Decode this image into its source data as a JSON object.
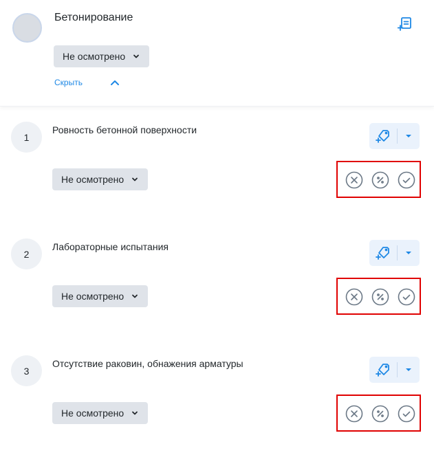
{
  "header": {
    "title": "Бетонирование",
    "status": "Не осмотрено",
    "hide_label": "Скрыть",
    "action_icon": "add-document-icon"
  },
  "items": [
    {
      "number": "1",
      "title": "Ровность бетонной поверхности",
      "status": "Не осмотрено"
    },
    {
      "number": "2",
      "title": "Лабораторные испытания",
      "status": "Не осмотрено"
    },
    {
      "number": "3",
      "title": "Отсутствие раковин, обнажения арматуры",
      "status": "Не осмотрено"
    }
  ],
  "colors": {
    "accent": "#1e88e5",
    "highlight_border": "#e00000",
    "status_bg": "#dfe3e9",
    "icon_gray": "#6b7886"
  }
}
